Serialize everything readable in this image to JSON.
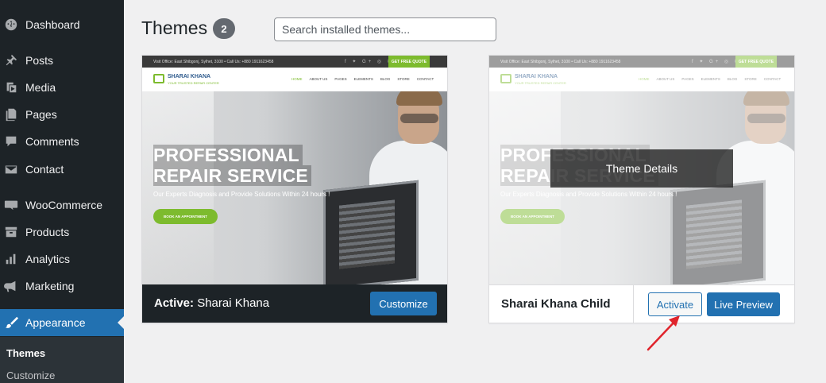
{
  "sidebar": {
    "items": [
      {
        "label": "Dashboard",
        "icon": "dashboard-icon"
      },
      {
        "label": "Posts",
        "icon": "pin-icon"
      },
      {
        "label": "Media",
        "icon": "media-icon"
      },
      {
        "label": "Pages",
        "icon": "pages-icon"
      },
      {
        "label": "Comments",
        "icon": "comments-icon"
      },
      {
        "label": "Contact",
        "icon": "mail-icon"
      },
      {
        "label": "WooCommerce",
        "icon": "woocommerce-icon"
      },
      {
        "label": "Products",
        "icon": "archive-icon"
      },
      {
        "label": "Analytics",
        "icon": "bar-chart-icon"
      },
      {
        "label": "Marketing",
        "icon": "megaphone-icon"
      },
      {
        "label": "Appearance",
        "icon": "paintbrush-icon"
      }
    ],
    "submenu": [
      "Themes",
      "Customize"
    ],
    "accent": "#2271b1"
  },
  "header": {
    "title": "Themes",
    "count": "2",
    "search_placeholder": "Search installed themes..."
  },
  "preview": {
    "topbar_info": "Visit Office: East Shibgonj, Sylhet, 3100  •  Call Us: +880 1911623458",
    "topbar_quote": "GET FREE QUOTE",
    "brand": "SHARAI KHANA",
    "tagline": "YOUR TRUSTED REPAIR CENTER",
    "nav": [
      "HOME",
      "ABOUT US",
      "PAGES",
      "ELEMENTS",
      "BLOG",
      "STORE",
      "CONTACT"
    ],
    "hero_line1": "PROFESSIONAL",
    "hero_line2": "REPAIR SERVICE",
    "hero_sub": "Our Experts Diagnosis and Provide Solutions Within 24 hours !",
    "hero_button": "BOOK AN APPOINTMENT"
  },
  "themes": [
    {
      "active_prefix": "Active:",
      "name": "Sharai Khana",
      "button": "Customize"
    },
    {
      "name": "Sharai Khana Child",
      "overlay": "Theme Details",
      "activate": "Activate",
      "live_preview": "Live Preview"
    }
  ]
}
